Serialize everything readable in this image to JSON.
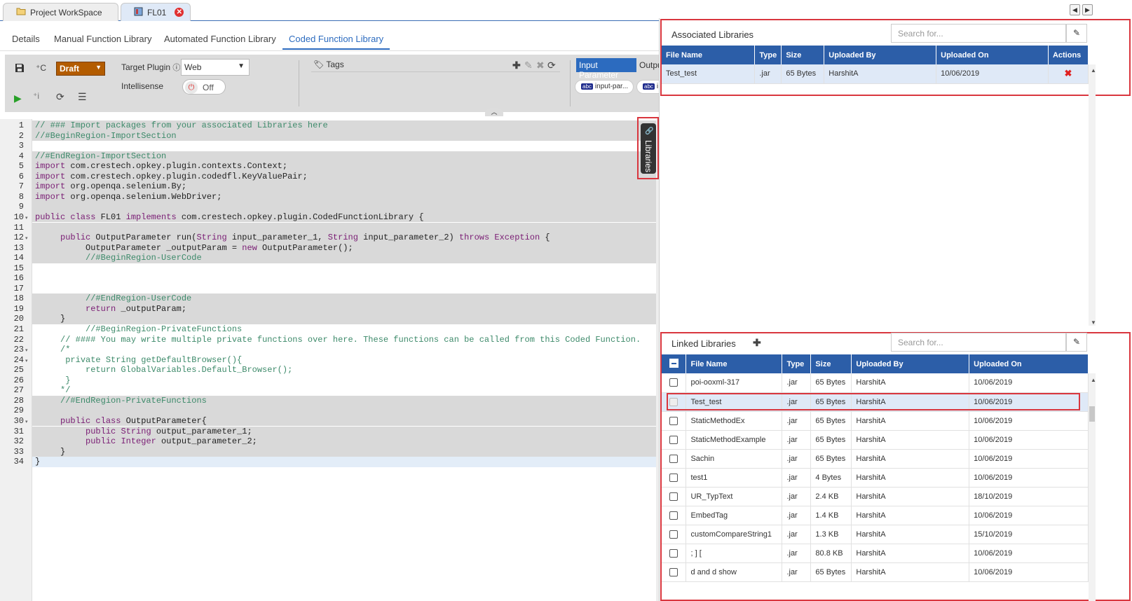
{
  "doc_tabs": {
    "workspace": "Project WorkSpace",
    "file": "FL01"
  },
  "sub_tabs": [
    "Details",
    "Manual Function Library",
    "Automated Function Library",
    "Coded Function Library"
  ],
  "toolbar": {
    "status": "Draft",
    "target_plugin_label": "Target Plugin",
    "target_plugin_value": "Web",
    "intellisense_label": "Intellisense",
    "intellisense_value": "Off",
    "tags_label": "Tags",
    "input_param_tab": "Input Parameter",
    "output_param_tab": "Outpu",
    "chips": [
      "input-par...",
      "i"
    ],
    "chip_icon": "abc"
  },
  "side_tab": {
    "label": "Libraries"
  },
  "associated": {
    "title": "Associated Libraries",
    "search_placeholder": "Search for...",
    "columns": [
      "File Name",
      "Type",
      "Size",
      "Uploaded By",
      "Uploaded On",
      "Actions"
    ],
    "rows": [
      {
        "name": "Test_test",
        "type": ".jar",
        "size": "65 Bytes",
        "by": "HarshitA",
        "on": "10/06/2019"
      }
    ]
  },
  "linked": {
    "title": "Linked Libraries",
    "search_placeholder": "Search for...",
    "columns": [
      "File Name",
      "Type",
      "Size",
      "Uploaded By",
      "Uploaded On"
    ],
    "rows": [
      {
        "name": "poi-ooxml-317",
        "type": ".jar",
        "size": "65 Bytes",
        "by": "HarshitA",
        "on": "10/06/2019"
      },
      {
        "name": "Test_test",
        "type": ".jar",
        "size": "65 Bytes",
        "by": "HarshitA",
        "on": "10/06/2019"
      },
      {
        "name": "StaticMethodEx",
        "type": ".jar",
        "size": "65 Bytes",
        "by": "HarshitA",
        "on": "10/06/2019"
      },
      {
        "name": "StaticMethodExample",
        "type": ".jar",
        "size": "65 Bytes",
        "by": "HarshitA",
        "on": "10/06/2019"
      },
      {
        "name": "Sachin",
        "type": ".jar",
        "size": "65 Bytes",
        "by": "HarshitA",
        "on": "10/06/2019"
      },
      {
        "name": "test1",
        "type": ".jar",
        "size": "4 Bytes",
        "by": "HarshitA",
        "on": "10/06/2019"
      },
      {
        "name": "UR_TypText",
        "type": ".jar",
        "size": "2.4 KB",
        "by": "HarshitA",
        "on": "18/10/2019"
      },
      {
        "name": "EmbedTag",
        "type": ".jar",
        "size": "1.4 KB",
        "by": "HarshitA",
        "on": "10/06/2019"
      },
      {
        "name": "customCompareString1",
        "type": ".jar",
        "size": "1.3 KB",
        "by": "HarshitA",
        "on": "15/10/2019"
      },
      {
        "name": "; ] [",
        "type": ".jar",
        "size": "80.8 KB",
        "by": "HarshitA",
        "on": "10/06/2019"
      },
      {
        "name": "d and d show",
        "type": ".jar",
        "size": "65 Bytes",
        "by": "HarshitA",
        "on": "10/06/2019"
      }
    ]
  },
  "code": {
    "line_numbers": [
      "1",
      "2",
      "3",
      "4",
      "5",
      "6",
      "7",
      "8",
      "9",
      "10",
      "11",
      "12",
      "13",
      "14",
      "15",
      "16",
      "17",
      "18",
      "19",
      "20",
      "21",
      "22",
      "23",
      "24",
      "25",
      "26",
      "27",
      "28",
      "29",
      "30",
      "31",
      "32",
      "33",
      "34"
    ],
    "lines": [
      [
        [
          "cm",
          "// ### Import packages from your associated Libraries here"
        ]
      ],
      [
        [
          "cm",
          "//#BeginRegion-ImportSection"
        ]
      ],
      [],
      [
        [
          "cm",
          "//#EndRegion-ImportSection"
        ]
      ],
      [
        [
          "kw",
          "import"
        ],
        [
          "tx",
          " com.crestech.opkey.plugin.contexts.Context;"
        ]
      ],
      [
        [
          "kw",
          "import"
        ],
        [
          "tx",
          " com.crestech.opkey.plugin.codedfl.KeyValuePair;"
        ]
      ],
      [
        [
          "kw",
          "import"
        ],
        [
          "tx",
          " org.openqa.selenium.By;"
        ]
      ],
      [
        [
          "kw",
          "import"
        ],
        [
          "tx",
          " org.openqa.selenium.WebDriver;"
        ]
      ],
      [],
      [
        [
          "kw",
          "public class"
        ],
        [
          "tx",
          " FL01 "
        ],
        [
          "kw",
          "implements"
        ],
        [
          "tx",
          " com.crestech.opkey.plugin.CodedFunctionLibrary {"
        ]
      ],
      [],
      [
        [
          "tx",
          "     "
        ],
        [
          "kw",
          "public"
        ],
        [
          "tx",
          " OutputParameter run("
        ],
        [
          "ty",
          "String"
        ],
        [
          "tx",
          " input_parameter_1, "
        ],
        [
          "ty",
          "String"
        ],
        [
          "tx",
          " input_parameter_2) "
        ],
        [
          "kw",
          "throws"
        ],
        [
          "tx",
          " "
        ],
        [
          "ty",
          "Exception"
        ],
        [
          "tx",
          " {"
        ]
      ],
      [
        [
          "tx",
          "          OutputParameter _outputParam = "
        ],
        [
          "kw",
          "new"
        ],
        [
          "tx",
          " OutputParameter();"
        ]
      ],
      [
        [
          "tx",
          "          "
        ],
        [
          "cm",
          "//#BeginRegion-UserCode"
        ]
      ],
      [],
      [],
      [],
      [
        [
          "tx",
          "          "
        ],
        [
          "cm",
          "//#EndRegion-UserCode"
        ]
      ],
      [
        [
          "tx",
          "          "
        ],
        [
          "kw",
          "return"
        ],
        [
          "tx",
          " _outputParam;"
        ]
      ],
      [
        [
          "tx",
          "     }"
        ]
      ],
      [
        [
          "tx",
          "          "
        ],
        [
          "cm",
          "//#BeginRegion-PrivateFunctions"
        ]
      ],
      [
        [
          "tx",
          "     "
        ],
        [
          "cm",
          "// #### You may write multiple private functions over here. These functions can be called from this Coded Function."
        ]
      ],
      [
        [
          "tx",
          "     "
        ],
        [
          "cm",
          "/*"
        ]
      ],
      [
        [
          "tx",
          "      "
        ],
        [
          "cm",
          "private String getDefaultBrowser(){"
        ]
      ],
      [
        [
          "tx",
          "          "
        ],
        [
          "cm",
          "return GlobalVariables.Default_Browser();"
        ]
      ],
      [
        [
          "tx",
          "      "
        ],
        [
          "cm",
          "}"
        ]
      ],
      [
        [
          "tx",
          "     "
        ],
        [
          "cm",
          "*/"
        ]
      ],
      [
        [
          "tx",
          "     "
        ],
        [
          "cm",
          "//#EndRegion-PrivateFunctions"
        ]
      ],
      [],
      [
        [
          "tx",
          "     "
        ],
        [
          "kw",
          "public class"
        ],
        [
          "tx",
          " OutputParameter{"
        ]
      ],
      [
        [
          "tx",
          "          "
        ],
        [
          "kw",
          "public"
        ],
        [
          "tx",
          " "
        ],
        [
          "ty",
          "String"
        ],
        [
          "tx",
          " output_parameter_1;"
        ]
      ],
      [
        [
          "tx",
          "          "
        ],
        [
          "kw",
          "public"
        ],
        [
          "tx",
          " "
        ],
        [
          "ty",
          "Integer"
        ],
        [
          "tx",
          " output_parameter_2;"
        ]
      ],
      [
        [
          "tx",
          "     }"
        ]
      ],
      [
        [
          "tx",
          "}"
        ]
      ]
    ]
  }
}
